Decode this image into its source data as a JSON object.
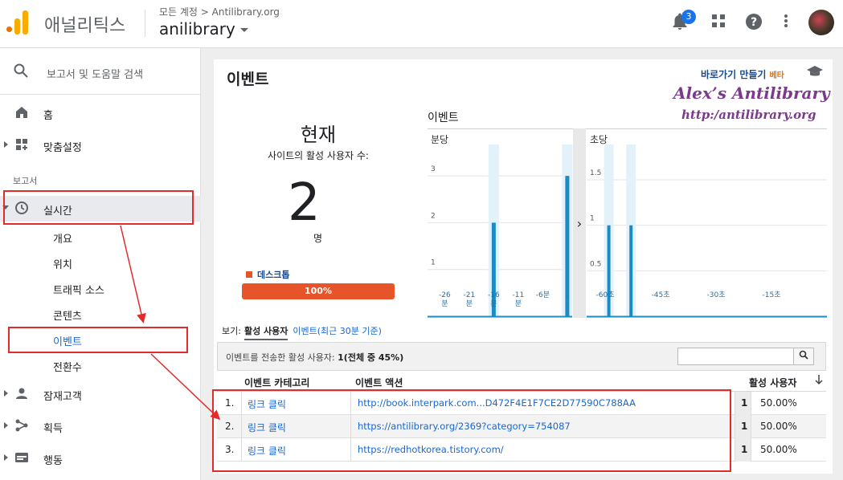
{
  "header": {
    "product_name": "애널리틱스",
    "account_path": "모든 계정 > Antilibrary.org",
    "property_name": "anilibrary",
    "notification_count": "3",
    "icons": [
      "bell-icon",
      "apps-grid-icon",
      "help-icon",
      "more-vert-icon",
      "avatar"
    ]
  },
  "sidebar": {
    "search_text": "보고서 및 도움말 검색",
    "items_top": [
      {
        "label": "홈",
        "icon": "home-icon"
      },
      {
        "label": "맞춤설정",
        "icon": "dashboard-icon"
      }
    ],
    "section_label": "보고서",
    "realtime_label": "실시간",
    "realtime_sub": [
      "개요",
      "위치",
      "트래픽 소스",
      "콘텐츠",
      "이벤트",
      "전환수"
    ],
    "items_bottom": [
      {
        "label": "잠재고객",
        "icon": "person-icon"
      },
      {
        "label": "획득",
        "icon": "acquisition-icon"
      },
      {
        "label": "행동",
        "icon": "behavior-icon"
      }
    ]
  },
  "main": {
    "title": "이벤트",
    "shortcut_label": "바로가기 만들기",
    "beta_label": "베타",
    "watermark_title": "Alex’s Antilibrary",
    "watermark_url": "http:/antilibrary.org",
    "now_title": "현재",
    "now_subtitle": "사이트의 활성 사용자 수:",
    "now_count": "2",
    "now_unit": "명",
    "device_label": "데스크톱",
    "device_percent_label": "100%",
    "device_share": 1.0,
    "events_chart_label": "이벤트",
    "view_label": "보기:",
    "tab_active": "활성 사용자",
    "tab_other": "이벤트(최근 30분 기준)",
    "summary_prefix": "이벤트를 전송한 활성 사용자: ",
    "summary_count": "1",
    "summary_mid": "(전체 중 ",
    "summary_pct": "45%",
    "summary_end": ")",
    "table_headers": {
      "category": "이벤트 카테고리",
      "action": "이벤트 액션",
      "users": "활성 사용자"
    },
    "rows": [
      {
        "idx": "1.",
        "category": "링크 클릭",
        "action": "http://book.interpark.com...D472F4E1F7CE2D77590C788AA",
        "count": "1",
        "pct": "50.00%"
      },
      {
        "idx": "2.",
        "category": "링크 클릭",
        "action": "https://antilibrary.org/2369?category=754087",
        "count": "1",
        "pct": "50.00%"
      },
      {
        "idx": "3.",
        "category": "링크 클릭",
        "action": "https://redhotkorea.tistory.com/",
        "count": "1",
        "pct": "50.00%"
      }
    ]
  },
  "chart_data": [
    {
      "type": "bar",
      "title": "분당",
      "yticks": [
        "3",
        "2",
        "1"
      ],
      "ylim": [
        0,
        3.5
      ],
      "xticks": [
        {
          "value": -26,
          "label": [
            "-26",
            "분"
          ]
        },
        {
          "value": -21,
          "label": [
            "-21",
            "분"
          ]
        },
        {
          "value": -16,
          "label": [
            "-16",
            "분"
          ]
        },
        {
          "value": -11,
          "label": [
            "-11",
            "분"
          ]
        },
        {
          "value": -6,
          "label": [
            "-6분"
          ]
        },
        {
          "value": -1,
          "label": [
            ".."
          ]
        }
      ],
      "x": [
        -16,
        -1
      ],
      "values": [
        2,
        3
      ],
      "xlim": [
        -29.5,
        0
      ]
    },
    {
      "type": "bar",
      "title": "초당",
      "yticks": [
        "1.5",
        "1",
        "0.5"
      ],
      "ylim": [
        0,
        1.8
      ],
      "xticks": [
        {
          "value": -60,
          "label": [
            "-60초"
          ]
        },
        {
          "value": -45,
          "label": [
            "-45초"
          ]
        },
        {
          "value": -30,
          "label": [
            "-30초"
          ]
        },
        {
          "value": -15,
          "label": [
            "-15초"
          ]
        }
      ],
      "x": [
        -59,
        -53
      ],
      "values": [
        1,
        1
      ],
      "xlim": [
        -65,
        0
      ]
    }
  ],
  "colors": {
    "accent": "#1a73e8",
    "bar": "#1a8bc4",
    "device": "#e8542a",
    "highlight": "#e32b2b"
  }
}
